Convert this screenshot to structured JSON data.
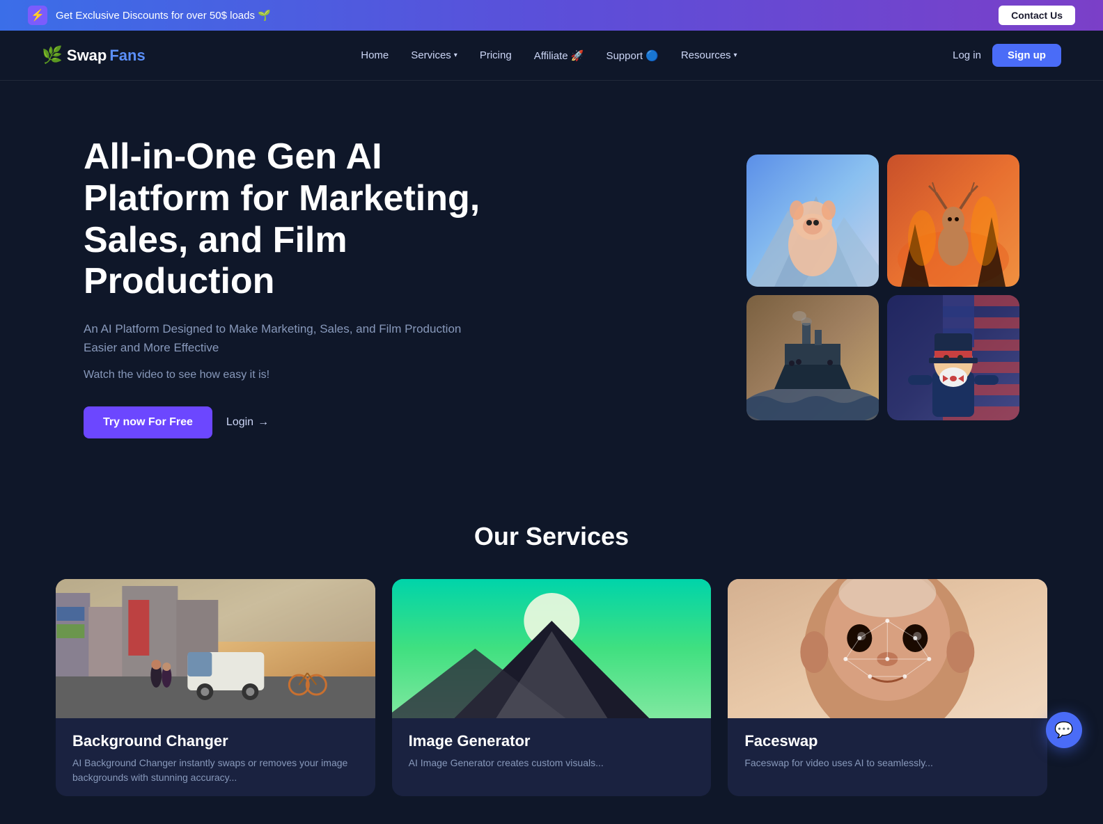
{
  "banner": {
    "icon": "⚡",
    "text": "Get Exclusive Discounts for over 50$ loads 🌱",
    "contact_btn": "Contact Us"
  },
  "navbar": {
    "logo": {
      "symbol": "🌿",
      "swap": "Swap",
      "fans": "Fans"
    },
    "links": [
      {
        "label": "Home",
        "has_dropdown": false
      },
      {
        "label": "Services",
        "has_dropdown": true
      },
      {
        "label": "Pricing",
        "has_dropdown": false
      },
      {
        "label": "Affiliate 🚀",
        "has_dropdown": false
      },
      {
        "label": "Support 🔵",
        "has_dropdown": false
      },
      {
        "label": "Resources",
        "has_dropdown": true
      }
    ],
    "login": "Log in",
    "signup": "Sign up"
  },
  "hero": {
    "title": "All-in-One Gen AI Platform for Marketing, Sales, and Film Production",
    "subtitle": "An AI Platform Designed to Make Marketing, Sales, and Film Production Easier and More Effective",
    "watch_text": "Watch the video to see how easy it is!",
    "cta_primary": "Try now For Free",
    "cta_secondary": "Login",
    "cta_arrow": "→"
  },
  "services": {
    "section_title": "Our Services",
    "cards": [
      {
        "title": "Background Changer",
        "desc": "AI Background Changer instantly swaps or removes your image backgrounds with stunning accuracy..."
      },
      {
        "title": "Image Generator",
        "desc": "AI Image Generator creates custom visuals..."
      },
      {
        "title": "Faceswap",
        "desc": "Faceswap for video uses AI to seamlessly..."
      }
    ]
  },
  "chat_icon": "💬"
}
